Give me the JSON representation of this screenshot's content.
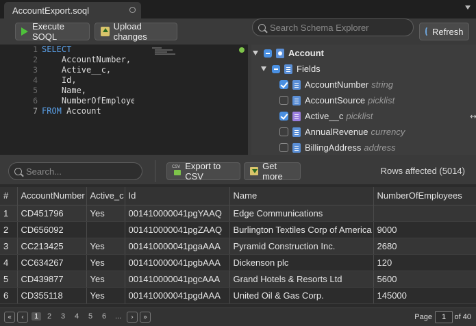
{
  "tab": {
    "title": "AccountExport.soql"
  },
  "toolbar": {
    "execute_label": "Execute SOQL",
    "upload_label": "Upload changes",
    "search_placeholder": "Search Schema Explorer",
    "refresh_label": "Refresh"
  },
  "editor": {
    "line_numbers": [
      "1",
      "2",
      "3",
      "4",
      "5",
      "6",
      "7"
    ],
    "lines": [
      {
        "kw": "SELECT",
        "text": ""
      },
      {
        "kw": "",
        "text": "    AccountNumber,"
      },
      {
        "kw": "",
        "text": "    Active__c,"
      },
      {
        "kw": "",
        "text": "    Id,"
      },
      {
        "kw": "",
        "text": "    Name,"
      },
      {
        "kw": "",
        "text": "    NumberOfEmployees"
      },
      {
        "kw": "FROM",
        "text": " Account"
      }
    ]
  },
  "schema": {
    "object": "Account",
    "fields_label": "Fields",
    "fields": [
      {
        "name": "AccountNumber",
        "type": "string",
        "checked": true
      },
      {
        "name": "AccountSource",
        "type": "picklist",
        "checked": false
      },
      {
        "name": "Active__c",
        "type": "picklist",
        "checked": true
      },
      {
        "name": "AnnualRevenue",
        "type": "currency",
        "checked": false
      },
      {
        "name": "BillingAddress",
        "type": "address",
        "checked": false
      }
    ]
  },
  "results_toolbar": {
    "search_placeholder": "Search...",
    "export_label": "Export to CSV",
    "export_icon_text": "CSV",
    "getmore_label": "Get more",
    "rows_affected": "Rows affected (5014)"
  },
  "table": {
    "columns": [
      "#",
      "AccountNumber",
      "Active_c",
      "Id",
      "Name",
      "NumberOfEmployees"
    ],
    "rows": [
      [
        "1",
        "CD451796",
        "Yes",
        "001410000041pgYAAQ",
        "Edge Communications",
        ""
      ],
      [
        "2",
        "CD656092",
        "",
        "001410000041pgZAAQ",
        "Burlington Textiles Corp of America",
        "9000"
      ],
      [
        "3",
        "CC213425",
        "Yes",
        "001410000041pgaAAA",
        "Pyramid Construction Inc.",
        "2680"
      ],
      [
        "4",
        "CC634267",
        "Yes",
        "001410000041pgbAAA",
        "Dickenson plc",
        "120"
      ],
      [
        "5",
        "CD439877",
        "Yes",
        "001410000041pgcAAA",
        "Grand Hotels & Resorts Ltd",
        "5600"
      ],
      [
        "6",
        "CD355118",
        "Yes",
        "001410000041pgdAAA",
        "United Oil & Gas Corp.",
        "145000"
      ]
    ]
  },
  "pager": {
    "first": "«",
    "prev": "‹",
    "next": "›",
    "last": "»",
    "pages": [
      "1",
      "2",
      "3",
      "4",
      "5",
      "6",
      "..."
    ],
    "page_label": "Page",
    "page_value": "1",
    "of_label": "of 40"
  },
  "colors": {
    "execute_icon": "#4ec23b",
    "accent_blue": "#4a90e2",
    "keyword": "#5aa0e8",
    "status_dot": "#7ec44a"
  }
}
